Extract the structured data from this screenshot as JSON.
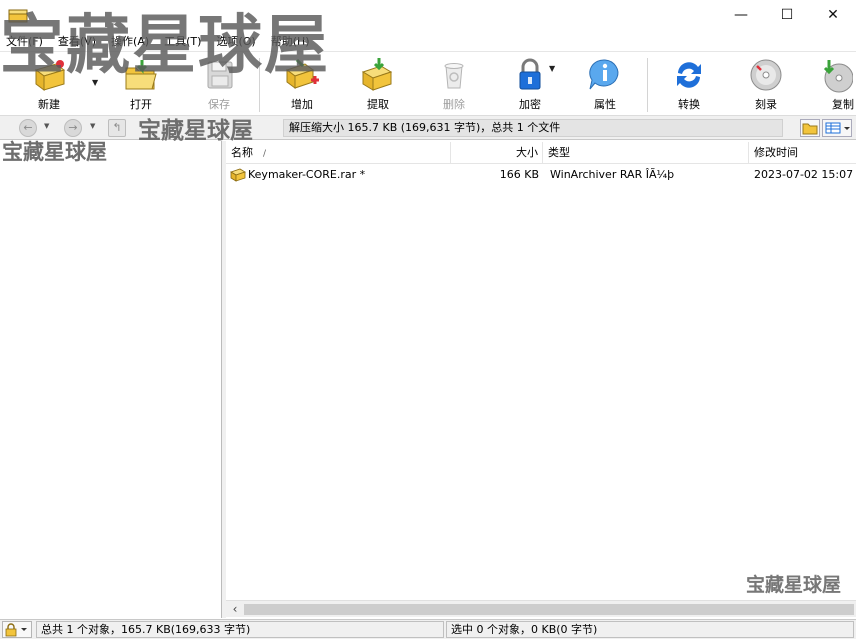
{
  "window": {
    "minimize": "—",
    "maximize": "☐",
    "close": "✕"
  },
  "menu": [
    "文件(F)",
    "查看(V)",
    "操作(A)",
    "工具(T)",
    "选项(O)",
    "帮助(H)"
  ],
  "toolbar": {
    "new": "新建",
    "open": "打开",
    "save": "保存",
    "add": "增加",
    "extract": "提取",
    "delete": "删除",
    "encrypt": "加密",
    "properties": "属性",
    "convert": "转换",
    "burn": "刻录",
    "copy": "复制"
  },
  "address": {
    "text": "解压缩大小 165.7 KB (169,631 字节)，总共 1 个文件"
  },
  "columns": {
    "name": "名称",
    "size": "大小",
    "type": "类型",
    "modified": "修改时间"
  },
  "files": [
    {
      "name": "Keymaker-CORE.rar *",
      "size": "166 KB",
      "type": "WinArchiver RAR ÎÃ¼þ",
      "modified": "2023-07-02 15:07"
    }
  ],
  "status": {
    "left": "总共 1 个对象，165.7 KB(169,633 字节)",
    "right": "选中 0 个对象，0 KB(0 字节)"
  },
  "watermark": {
    "text": "宝藏星球屋"
  },
  "colors": {
    "accent_blue": "#1e6fd9",
    "archive_yellow": "#f2c43c",
    "plus_red": "#e0303a",
    "disabled_gray": "#9c9c9c"
  },
  "icons": {
    "new": "new-archive-icon",
    "open": "open-folder-icon",
    "save": "save-disk-icon",
    "add": "add-files-icon",
    "extract": "extract-icon",
    "delete": "recycle-bin-icon",
    "encrypt": "padlock-icon",
    "properties": "info-icon",
    "convert": "convert-arrows-icon",
    "burn": "disc-icon",
    "copy": "copy-disc-icon"
  }
}
